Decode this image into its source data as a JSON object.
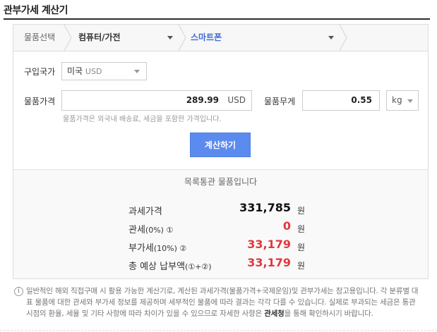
{
  "page": {
    "title": "관부가세 계산기"
  },
  "selector": {
    "label": "물품선택",
    "category": "컴퓨터/가전",
    "subcategory": "스마트폰"
  },
  "form": {
    "country_label": "구입국가",
    "country_value": "미국",
    "country_currency": "USD",
    "price_label": "물품가격",
    "price_value": "289.99",
    "price_unit": "USD",
    "weight_label": "물품무게",
    "weight_value": "0.55",
    "weight_unit": "kg",
    "hint": "물품가격은 외국내 배송료, 세금을 포함한 가격입니다.",
    "calc_button": "계산하기"
  },
  "result": {
    "notice": "목록통관 물품입니다",
    "rows": [
      {
        "label": "과세가격",
        "sub": "",
        "value": "331,785",
        "unit": "원"
      },
      {
        "label": "관세",
        "sub": "(0%) ①",
        "value": "0",
        "unit": "원"
      },
      {
        "label": "부가세",
        "sub": "(10%) ②",
        "value": "33,179",
        "unit": "원"
      },
      {
        "label": "총 예상 납부액",
        "sub": "(①+②)",
        "value": "33,179",
        "unit": "원"
      }
    ]
  },
  "footer": {
    "icon": "i",
    "text_before": "일반적인 해외 직접구매 시 활용 가능한 계산기로, 계산된 과세가격(물품가격+국제운임)및 관부가세는 참고용입니다. 각 분류별 대표 물품에 대한 관세와 부가세 정보를 제공하며 세부적인 물품에 따라 결과는 각각 다를 수 있습니다. 실제로 부과되는 세금은 통관 시점의 환율, 세율 및 기타 사항에 따라 차이가 있을 수 있으므로 자세한 사항은 ",
    "link": "관세청",
    "text_after": "을 통해 확인하시기 바랍니다."
  },
  "colors": {
    "accent_blue": "#5c8bef",
    "link_blue": "#3d6bd6",
    "value_red": "#e0383e"
  }
}
